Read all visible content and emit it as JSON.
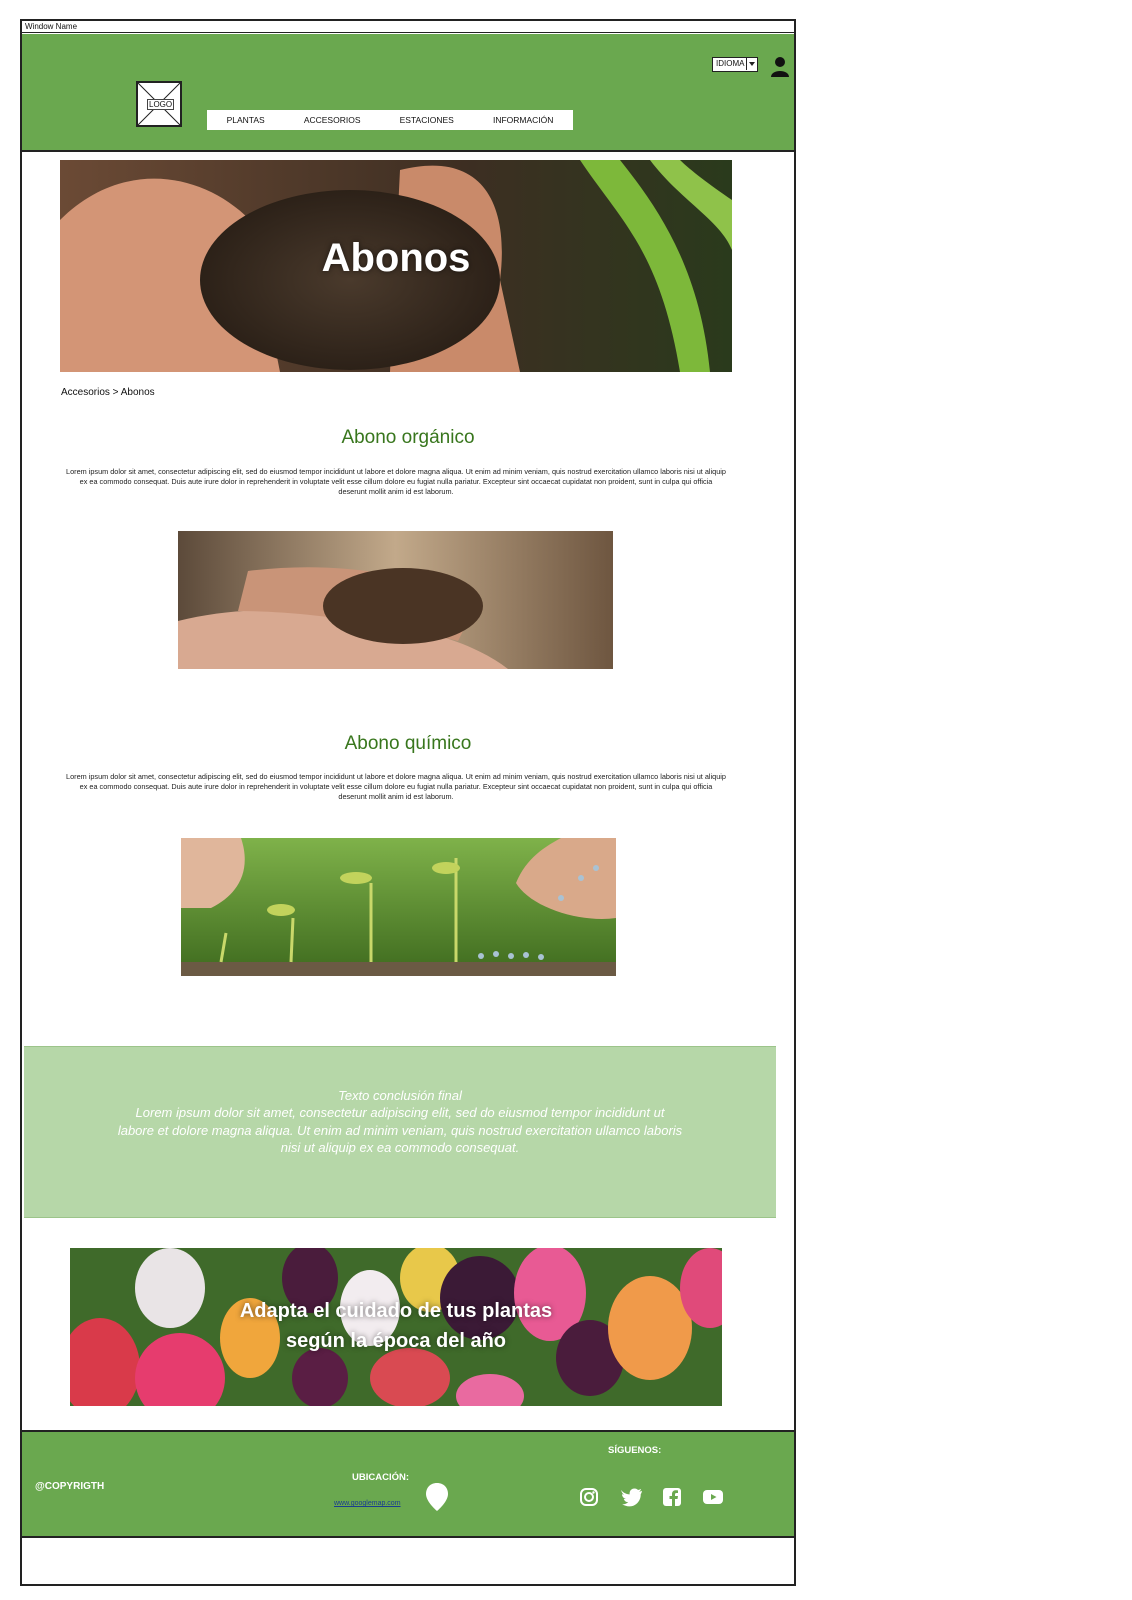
{
  "window": {
    "title": "Window Name"
  },
  "header": {
    "logo_label": "LOGO",
    "language_select": {
      "value": "IDIOMA"
    },
    "nav": [
      "PLANTAS",
      "ACCESORIOS",
      "ESTACIONES",
      "INFORMACIÓN"
    ],
    "colors": {
      "header_bg": "#6aa84f"
    }
  },
  "hero": {
    "title": "Abonos"
  },
  "breadcrumb": "Accesorios > Abonos",
  "sections": [
    {
      "title": "Abono orgánico",
      "text": "Lorem ipsum dolor sit amet, consectetur adipiscing elit, sed do eiusmod tempor incididunt ut labore et dolore magna aliqua. Ut enim ad minim veniam, quis nostrud exercitation ullamco laboris nisi ut aliquip ex ea commodo consequat. Duis aute irure dolor in reprehenderit in voluptate velit esse cillum dolore eu fugiat nulla pariatur. Excepteur sint occaecat cupidatat non proident, sunt in culpa qui officia deserunt mollit anim id est laborum."
    },
    {
      "title": "Abono químico",
      "text": "Lorem ipsum dolor sit amet, consectetur adipiscing elit, sed do eiusmod tempor incididunt ut labore et dolore magna aliqua. Ut enim ad minim veniam, quis nostrud exercitation ullamco laboris nisi ut aliquip ex ea commodo consequat. Duis aute irure dolor in reprehenderit in voluptate velit esse cillum dolore eu fugiat nulla pariatur. Excepteur sint occaecat cupidatat non proident, sunt in culpa qui officia deserunt mollit anim id est laborum."
    }
  ],
  "conclusion": {
    "title": "Texto conclusión final",
    "text": "Lorem ipsum dolor sit amet, consectetur adipiscing elit, sed do eiusmod tempor incididunt ut labore et dolore magna aliqua. Ut enim ad minim veniam, quis nostrud exercitation ullamco laboris nisi ut aliquip ex ea commodo consequat."
  },
  "banner": {
    "line1": "Adapta el cuidado de tus plantas",
    "line2": "según la época del año"
  },
  "footer": {
    "copyright": "@COPYRIGTH",
    "location_label": "UBICACIÓN:",
    "location_link": "www.googlemap.com",
    "follow_label": "SÍGUENOS:",
    "social_icons": [
      "instagram-icon",
      "twitter-icon",
      "facebook-icon",
      "youtube-icon"
    ]
  }
}
